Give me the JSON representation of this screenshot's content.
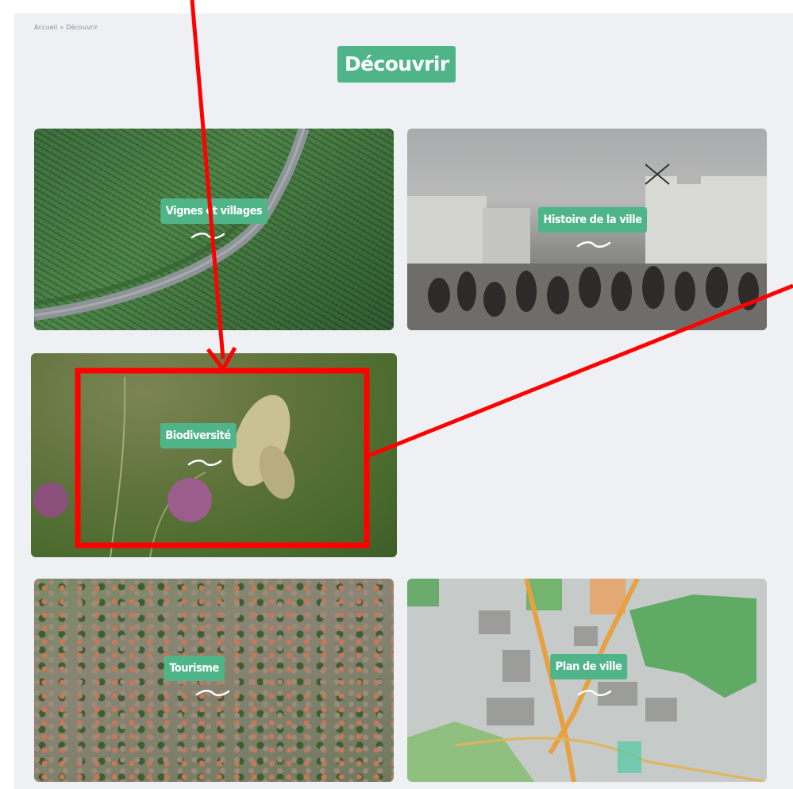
{
  "breadcrumb": {
    "home": "Accueil",
    "separator": "»",
    "current": "Découvrir"
  },
  "page_title": "Découvrir",
  "cards": [
    {
      "label": "Vignes et villages"
    },
    {
      "label": "Histoire de la ville"
    },
    {
      "label": "Biodiversité"
    },
    {
      "label": "Tourisme"
    },
    {
      "label": "Plan de ville"
    }
  ],
  "colors": {
    "accent": "#4fb589",
    "page_background": "#eef0f4",
    "annotation": "#ff0000"
  }
}
